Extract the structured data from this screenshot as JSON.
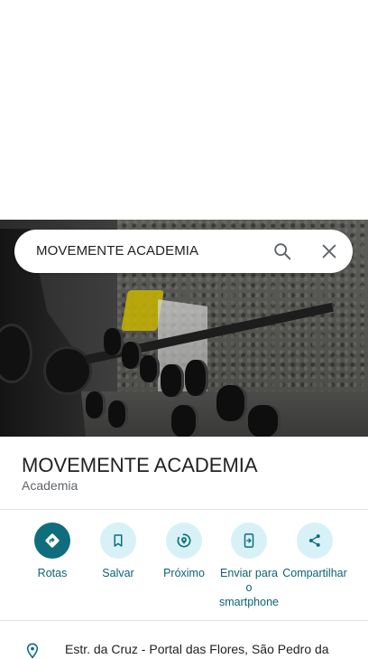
{
  "search": {
    "query": "MOVEMENTE ACADEMIA"
  },
  "place": {
    "name": "MOVEMENTE ACADEMIA",
    "category": "Academia"
  },
  "actions": [
    {
      "label": "Rotas",
      "icon": "directions-icon"
    },
    {
      "label": "Salvar",
      "icon": "bookmark-icon"
    },
    {
      "label": "Próximo",
      "icon": "nearby-icon"
    },
    {
      "label": "Enviar para o smartphone",
      "icon": "send-to-phone-icon"
    },
    {
      "label": "Compartilhar",
      "icon": "share-icon"
    }
  ],
  "address": {
    "text": "Estr. da Cruz - Portal das Flores, São Pedro da"
  },
  "colors": {
    "accent": "#0f6d7d",
    "action_bg": "#d7f1f7",
    "action_text": "#0b6472"
  }
}
